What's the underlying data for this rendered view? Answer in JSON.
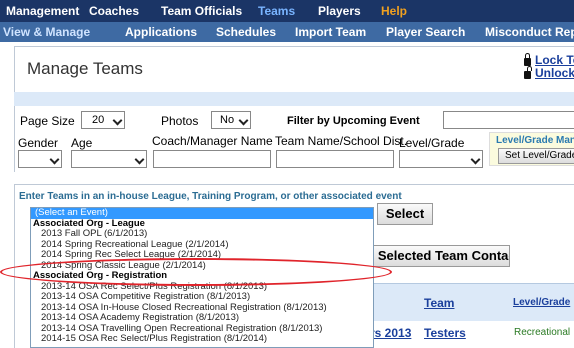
{
  "top_nav": [
    "Management",
    "Coaches",
    "Team Officials",
    "Teams",
    "Players",
    "Help"
  ],
  "top_nav_active": "Teams",
  "sub_nav": [
    "View & Manage",
    "Applications",
    "Schedules",
    "Import Team",
    "Player Search",
    "Misconduct Rep"
  ],
  "header": {
    "title": "Manage Teams",
    "lock_label": "Lock Team",
    "unlock_label": "Unlock Tea"
  },
  "filters": {
    "page_size_label": "Page Size",
    "page_size_value": "20",
    "photos_label": "Photos",
    "photos_value": "No",
    "upcoming_label": "Filter by Upcoming Event",
    "gender_label": "Gender",
    "age_label": "Age",
    "coach_label": "Coach/Manager Name",
    "team_school_label": "Team Name/School Dist.",
    "level_label": "Level/Grade",
    "level_box_title": "Level/Grade Mana",
    "level_box_button": "Set Level/Grade :"
  },
  "event": {
    "label": "Enter Teams in an in-house League, Training Program, or other associated event",
    "select_button": "Select",
    "options": [
      {
        "text": "(Select an Event)",
        "kind": "selected"
      },
      {
        "text": "Associated Org - League",
        "kind": "group"
      },
      {
        "text": "2013 Fall OPL (6/1/2013)",
        "kind": "opt"
      },
      {
        "text": "2014 Spring Recreational League (2/1/2014)",
        "kind": "opt"
      },
      {
        "text": "2014 Spring Rec Select League (2/1/2014)",
        "kind": "opt"
      },
      {
        "text": "2014 Spring Classic League (2/1/2014)",
        "kind": "opt"
      },
      {
        "text": "Associated Org - Registration",
        "kind": "group"
      },
      {
        "text": "2013-14 OSA Rec Select/Plus Registration (8/1/2013)",
        "kind": "opt"
      },
      {
        "text": "2013-14 OSA Competitive Registration (8/1/2013)",
        "kind": "opt"
      },
      {
        "text": "2013-14 OSA In-House Closed Recreational Registration (8/1/2013)",
        "kind": "opt"
      },
      {
        "text": "2013-14 OSA Academy Registration (8/1/2013)",
        "kind": "opt"
      },
      {
        "text": "2013-14 OSA Travelling Open Recreational Registration (8/1/2013)",
        "kind": "opt"
      },
      {
        "text": "2014-15 OSA Rec Select/Plus Registration (8/1/2014)",
        "kind": "opt"
      }
    ]
  },
  "contacts_button": "Add Selected Team Contacts",
  "table": {
    "headers": [
      "Team",
      "Level/Grade"
    ],
    "row": {
      "prefix": "rs 2013",
      "team": "Testers",
      "level": "Recreational"
    }
  },
  "colors": {
    "nav_bg": "#1b3566",
    "subnav_bg": "#3e6aa3",
    "active_tab": "#79b4ff",
    "help": "#f0a020",
    "link": "#1a3f9c",
    "highlight_ellipse": "#e0242b"
  }
}
